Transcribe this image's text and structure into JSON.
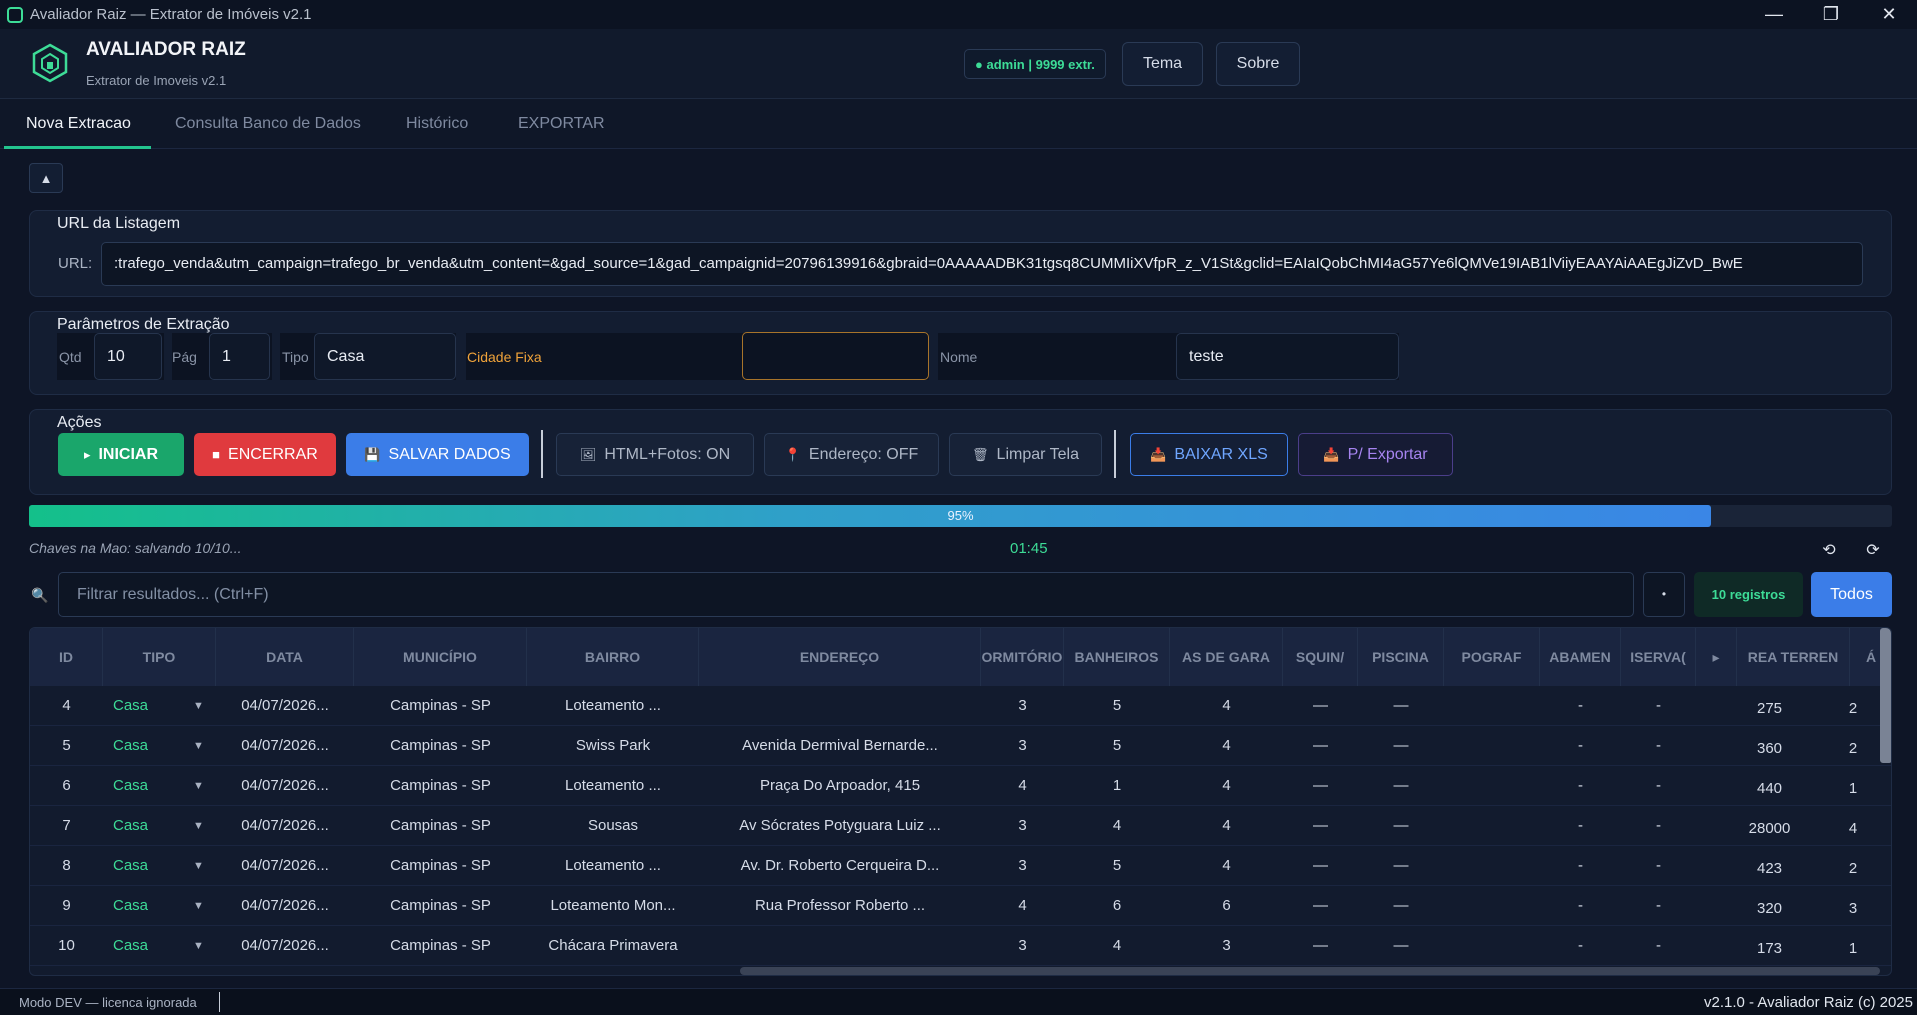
{
  "window": {
    "title": "Avaliador Raiz — Extrator de Imóveis v2.1"
  },
  "header": {
    "title": "AVALIADOR RAIZ",
    "subtitle": "Extrator de Imoveis v2.1",
    "status": "● admin | 9999 extr.",
    "btn_tema": "Tema",
    "btn_sobre": "Sobre"
  },
  "tabs": [
    "Nova Extracao",
    "Consulta Banco de Dados",
    "Histórico",
    "EXPORTAR"
  ],
  "collapse_icon": "▲",
  "url_panel": {
    "title": "URL da Listagem",
    "label": "URL:",
    "value": ":trafego_venda&utm_campaign=trafego_br_venda&utm_content=&gad_source=1&gad_campaignid=20796139916&gbraid=0AAAAADBK31tgsq8CUMMIiXVfpR_z_V1St&gclid=EAIaIQobChMI4aG57Ye6lQMVe19IAB1lViiyEAAYAiAAEgJiZvD_BwE"
  },
  "params_panel": {
    "title": "Parâmetros de Extração",
    "qtd_label": "Qtd",
    "qtd_value": "10",
    "pag_label": "Pág",
    "pag_value": "1",
    "tipo_label": "Tipo",
    "tipo_value": "Casa",
    "cidade_label": "Cidade Fixa",
    "cidade_value": "",
    "nome_label": "Nome",
    "nome_value": "teste"
  },
  "actions_panel": {
    "title": "Ações",
    "iniciar": "INICIAR",
    "encerrar": "ENCERRAR",
    "salvar": "SALVAR DADOS",
    "html_fotos": "HTML+Fotos: ON",
    "endereco": "Endereço: OFF",
    "limpar": "Limpar Tela",
    "baixar_xls": "BAIXAR XLS",
    "p_exportar": "P/ Exportar"
  },
  "progress": {
    "percent": 95,
    "label": "95%"
  },
  "status": {
    "text": "Chaves na Mao: salvando 10/10...",
    "timer": "01:45"
  },
  "filter": {
    "placeholder": "Filtrar resultados... (Ctrl+F)",
    "records": "10 registros",
    "todos": "Todos"
  },
  "table": {
    "headers": [
      "ID",
      "TIPO",
      "DATA",
      "MUNICÍPIO",
      "BAIRRO",
      "ENDEREÇO",
      "ORMITÓRIO",
      "BANHEIROS",
      "AS DE GARA",
      "SQUIN/",
      "PISCINA",
      "POGRAF",
      "ABAMEN",
      "ISERVA(",
      "▸",
      "REA TERREN",
      "Á"
    ],
    "rows": [
      {
        "id": "4",
        "tipo": "Casa",
        "data": "04/07/2026...",
        "municipio": "Campinas - SP",
        "bairro": "Loteamento ...",
        "endereco": "",
        "dorm": "3",
        "banh": "5",
        "gar": "4",
        "esq": "—",
        "pisc": "—",
        "topo": "",
        "acab": "-",
        "cons": "-",
        "area": "275",
        "a2": "2"
      },
      {
        "id": "5",
        "tipo": "Casa",
        "data": "04/07/2026...",
        "municipio": "Campinas - SP",
        "bairro": "Swiss Park",
        "endereco": "Avenida Dermival Bernarde...",
        "dorm": "3",
        "banh": "5",
        "gar": "4",
        "esq": "—",
        "pisc": "—",
        "topo": "",
        "acab": "-",
        "cons": "-",
        "area": "360",
        "a2": "2"
      },
      {
        "id": "6",
        "tipo": "Casa",
        "data": "04/07/2026...",
        "municipio": "Campinas - SP",
        "bairro": "Loteamento ...",
        "endereco": "Praça Do Arpoador, 415",
        "dorm": "4",
        "banh": "1",
        "gar": "4",
        "esq": "—",
        "pisc": "—",
        "topo": "",
        "acab": "-",
        "cons": "-",
        "area": "440",
        "a2": "1"
      },
      {
        "id": "7",
        "tipo": "Casa",
        "data": "04/07/2026...",
        "municipio": "Campinas - SP",
        "bairro": "Sousas",
        "endereco": "Av Sócrates Potyguara Luiz ...",
        "dorm": "3",
        "banh": "4",
        "gar": "4",
        "esq": "—",
        "pisc": "—",
        "topo": "",
        "acab": "-",
        "cons": "-",
        "area": "28000",
        "a2": "4"
      },
      {
        "id": "8",
        "tipo": "Casa",
        "data": "04/07/2026...",
        "municipio": "Campinas - SP",
        "bairro": "Loteamento ...",
        "endereco": "Av. Dr. Roberto Cerqueira D...",
        "dorm": "3",
        "banh": "5",
        "gar": "4",
        "esq": "—",
        "pisc": "—",
        "topo": "",
        "acab": "-",
        "cons": "-",
        "area": "423",
        "a2": "2"
      },
      {
        "id": "9",
        "tipo": "Casa",
        "data": "04/07/2026...",
        "municipio": "Campinas - SP",
        "bairro": "Loteamento Mon...",
        "endereco": "Rua Professor Roberto ...",
        "dorm": "4",
        "banh": "6",
        "gar": "6",
        "esq": "—",
        "pisc": "—",
        "topo": "",
        "acab": "-",
        "cons": "-",
        "area": "320",
        "a2": "3"
      },
      {
        "id": "10",
        "tipo": "Casa",
        "data": "04/07/2026...",
        "municipio": "Campinas - SP",
        "bairro": "Chácara Primavera",
        "endereco": "",
        "dorm": "3",
        "banh": "4",
        "gar": "3",
        "esq": "—",
        "pisc": "—",
        "topo": "",
        "acab": "-",
        "cons": "-",
        "area": "173",
        "a2": "1"
      }
    ]
  },
  "footer": {
    "left": "Modo DEV — licenca ignorada",
    "right": "v2.1.0 - Avaliador Raiz (c) 2025"
  }
}
